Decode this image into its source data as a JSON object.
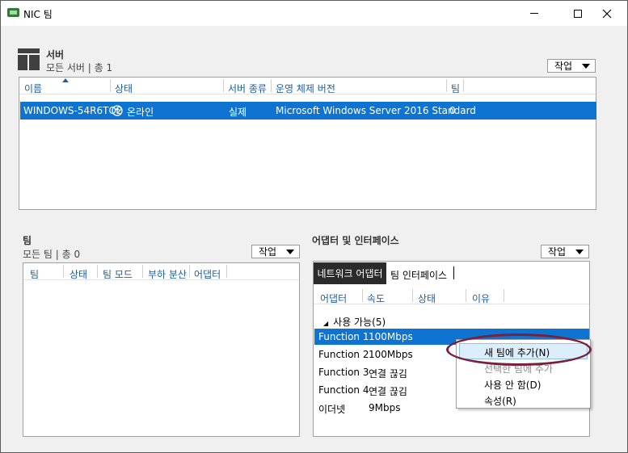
{
  "window": {
    "title": "NIC 팀"
  },
  "servers": {
    "title": "서버",
    "subtitle": "모든 서버 | 총 1",
    "task_label": "작업",
    "columns": [
      "이름",
      "상태",
      "서버 종류",
      "운영 체제 버전",
      "팀"
    ],
    "rows": [
      {
        "name": "WINDOWS-54R6TO2",
        "status": "온라인",
        "type": "실제",
        "os": "Microsoft Windows Server 2016 Standard",
        "teams": "0"
      }
    ]
  },
  "teams": {
    "title": "팀",
    "subtitle": "모든 팀 | 총 0",
    "task_label": "작업",
    "columns": [
      "팀",
      "상태",
      "팀 모드",
      "부하 분산",
      "어댑터"
    ]
  },
  "adapters": {
    "title": "어댑터 및 인터페이스",
    "task_label": "작업",
    "tabs": [
      "네트워크 어댑터",
      "팀 인터페이스"
    ],
    "columns": [
      "어댑터",
      "속도",
      "상태",
      "이유"
    ],
    "group_label": "사용 가능(5)",
    "rows": [
      {
        "name": "Function 1",
        "speed": "100Mbps"
      },
      {
        "name": "Function 2",
        "speed": "100Mbps"
      },
      {
        "name": "Function 3",
        "speed": "연결 끊김"
      },
      {
        "name": "Function 4",
        "speed": "연결 끊김"
      },
      {
        "name": "이더넷",
        "speed": "9Mbps"
      }
    ]
  },
  "context_menu": {
    "items": [
      "새 팀에 추가(N)",
      "선택한 팀에 추가",
      "사용 안 함(D)",
      "속성(R)"
    ]
  },
  "colors": {
    "selection": "#0f74d1",
    "header_text": "#1e5fa0",
    "annotation": "#7a1f3c"
  }
}
